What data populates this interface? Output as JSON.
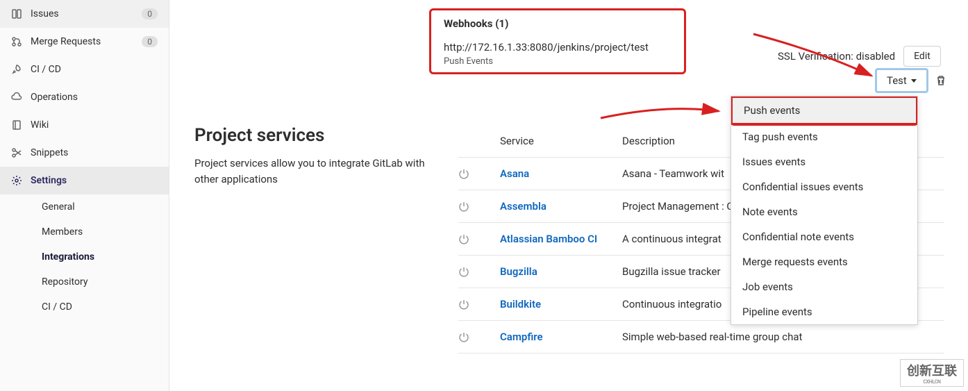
{
  "sidebar": {
    "items": [
      {
        "icon": "issues",
        "label": "Issues",
        "badge": "0"
      },
      {
        "icon": "merge",
        "label": "Merge Requests",
        "badge": "0"
      },
      {
        "icon": "rocket",
        "label": "CI / CD"
      },
      {
        "icon": "cloud",
        "label": "Operations"
      },
      {
        "icon": "book",
        "label": "Wiki"
      },
      {
        "icon": "scissors",
        "label": "Snippets"
      },
      {
        "icon": "gear",
        "label": "Settings",
        "active": true
      }
    ],
    "subitems": [
      {
        "label": "General"
      },
      {
        "label": "Members"
      },
      {
        "label": "Integrations",
        "active": true
      },
      {
        "label": "Repository"
      },
      {
        "label": "CI / CD"
      }
    ]
  },
  "webhooks": {
    "title": "Webhooks (1)",
    "url": "http://172.16.1.33:8080/jenkins/project/test",
    "events": "Push Events",
    "ssl": "SSL Verification: disabled",
    "edit": "Edit",
    "test": "Test"
  },
  "dropdown": [
    "Push events",
    "Tag push events",
    "Issues events",
    "Confidential issues events",
    "Note events",
    "Confidential note events",
    "Merge requests events",
    "Job events",
    "Pipeline events"
  ],
  "section": {
    "title": "Project services",
    "desc": "Project services allow you to integrate GitLab with other applications"
  },
  "table": {
    "headers": {
      "service": "Service",
      "description": "Description"
    },
    "rows": [
      {
        "name": "Asana",
        "desc": "Asana - Teamwork wit"
      },
      {
        "name": "Assembla",
        "desc": "Project Management : Commits Endpoint)"
      },
      {
        "name": "Atlassian Bamboo CI",
        "desc": "A continuous integrat"
      },
      {
        "name": "Bugzilla",
        "desc": "Bugzilla issue tracker"
      },
      {
        "name": "Buildkite",
        "desc": "Continuous integratio"
      },
      {
        "name": "Campfire",
        "desc": "Simple web-based real-time group chat"
      }
    ]
  },
  "watermark": {
    "main": "创新互联",
    "sub": "CXHLCN"
  }
}
